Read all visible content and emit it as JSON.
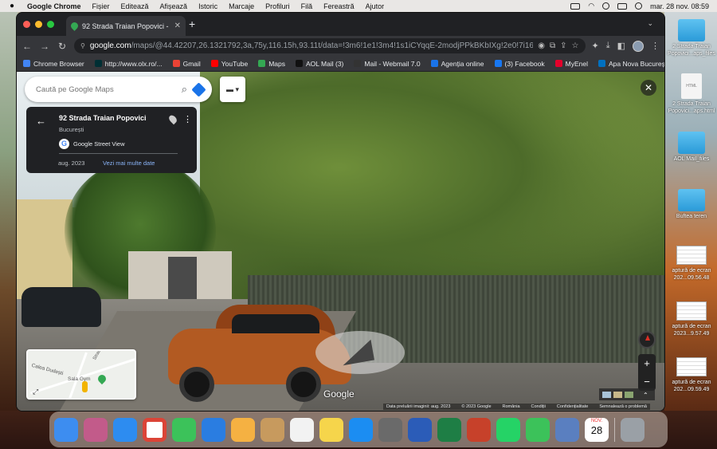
{
  "menubar": {
    "app": "Google Chrome",
    "items": [
      "Fișier",
      "Editează",
      "Afișează",
      "Istoric",
      "Marcaje",
      "Profiluri",
      "Filă",
      "Fereastră",
      "Ajutor"
    ],
    "datetime": "mar. 28 nov.  08:59"
  },
  "tab": {
    "title": "92 Strada Traian Popovici - Go"
  },
  "omnibox": {
    "host": "google.com",
    "path": "/maps/@44.42207,26.1321792,3a,75y,116.15h,93.11t/data=!3m6!1e1!3m4!1s1iCYqqE-2modjPPkBKbIXg!2e0!7i1638..."
  },
  "bookmarks": [
    {
      "label": "Chrome Browser",
      "color": "#4285f4"
    },
    {
      "label": "http://www.olx.ro/...",
      "color": "#002f34"
    },
    {
      "label": "Gmail",
      "color": "#ea4335"
    },
    {
      "label": "YouTube",
      "color": "#ff0000"
    },
    {
      "label": "Maps",
      "color": "#34a853"
    },
    {
      "label": "AOL Mail (3)",
      "color": "#111111"
    },
    {
      "label": "Mail - Webmail 7.0",
      "color": "#333333"
    },
    {
      "label": "Agenția online",
      "color": "#1a73e8"
    },
    {
      "label": "(3) Facebook",
      "color": "#1877f2"
    },
    {
      "label": "MyEnel",
      "color": "#e4002b"
    },
    {
      "label": "Apa Nova Bucureș...",
      "color": "#0070c0"
    }
  ],
  "maps": {
    "search_placeholder": "Caută pe Google Maps",
    "card": {
      "title": "92 Strada Traian Popovici",
      "city": "București",
      "source": "Google Street View",
      "date": "aug. 2023",
      "see_more": "Vezi mai multe date"
    },
    "minimap": {
      "street1": "Calea Dudești",
      "poi": "Sala Gym",
      "street2": "Strad"
    },
    "logo": "Google",
    "footer": [
      "Data preluării imaginii: aug. 2023",
      "© 2023 Google",
      "România",
      "Condiții",
      "Confidențialitate",
      "Semnalează o problemă"
    ]
  },
  "desktop": [
    {
      "label": "2 Strada Traian Popovici...aps_files",
      "kind": "folder"
    },
    {
      "label": "2 Strada Traian Popovici...aps.html",
      "kind": "file"
    },
    {
      "label": "AOL Mail_files",
      "kind": "folder"
    },
    {
      "label": "Buftea teren",
      "kind": "folder"
    },
    {
      "label": "aptură de ecran 202...09.56.48",
      "kind": "shot"
    },
    {
      "label": "aptură de ecran 2023...9.57.49",
      "kind": "shot"
    },
    {
      "label": "aptură de ecran 202...09.59.49",
      "kind": "shot"
    }
  ],
  "file_icon_label": "HTML",
  "dock": {
    "calendar_month": "NOV.",
    "calendar_day": "28",
    "apps": [
      "#3d8df0",
      "#c25b8a",
      "#2d8cf0",
      "#ffffff",
      "#3cc25a",
      "#2a7de1",
      "#f5b142",
      "#c79a5e",
      "#f2f2f2",
      "#f6d54b",
      "#1b8df2",
      "#6a6a6a",
      "#2b5cb8",
      "#1e7e45",
      "#c7412a",
      "#25d366",
      "#3cc25a",
      "#5a7fc0"
    ]
  }
}
